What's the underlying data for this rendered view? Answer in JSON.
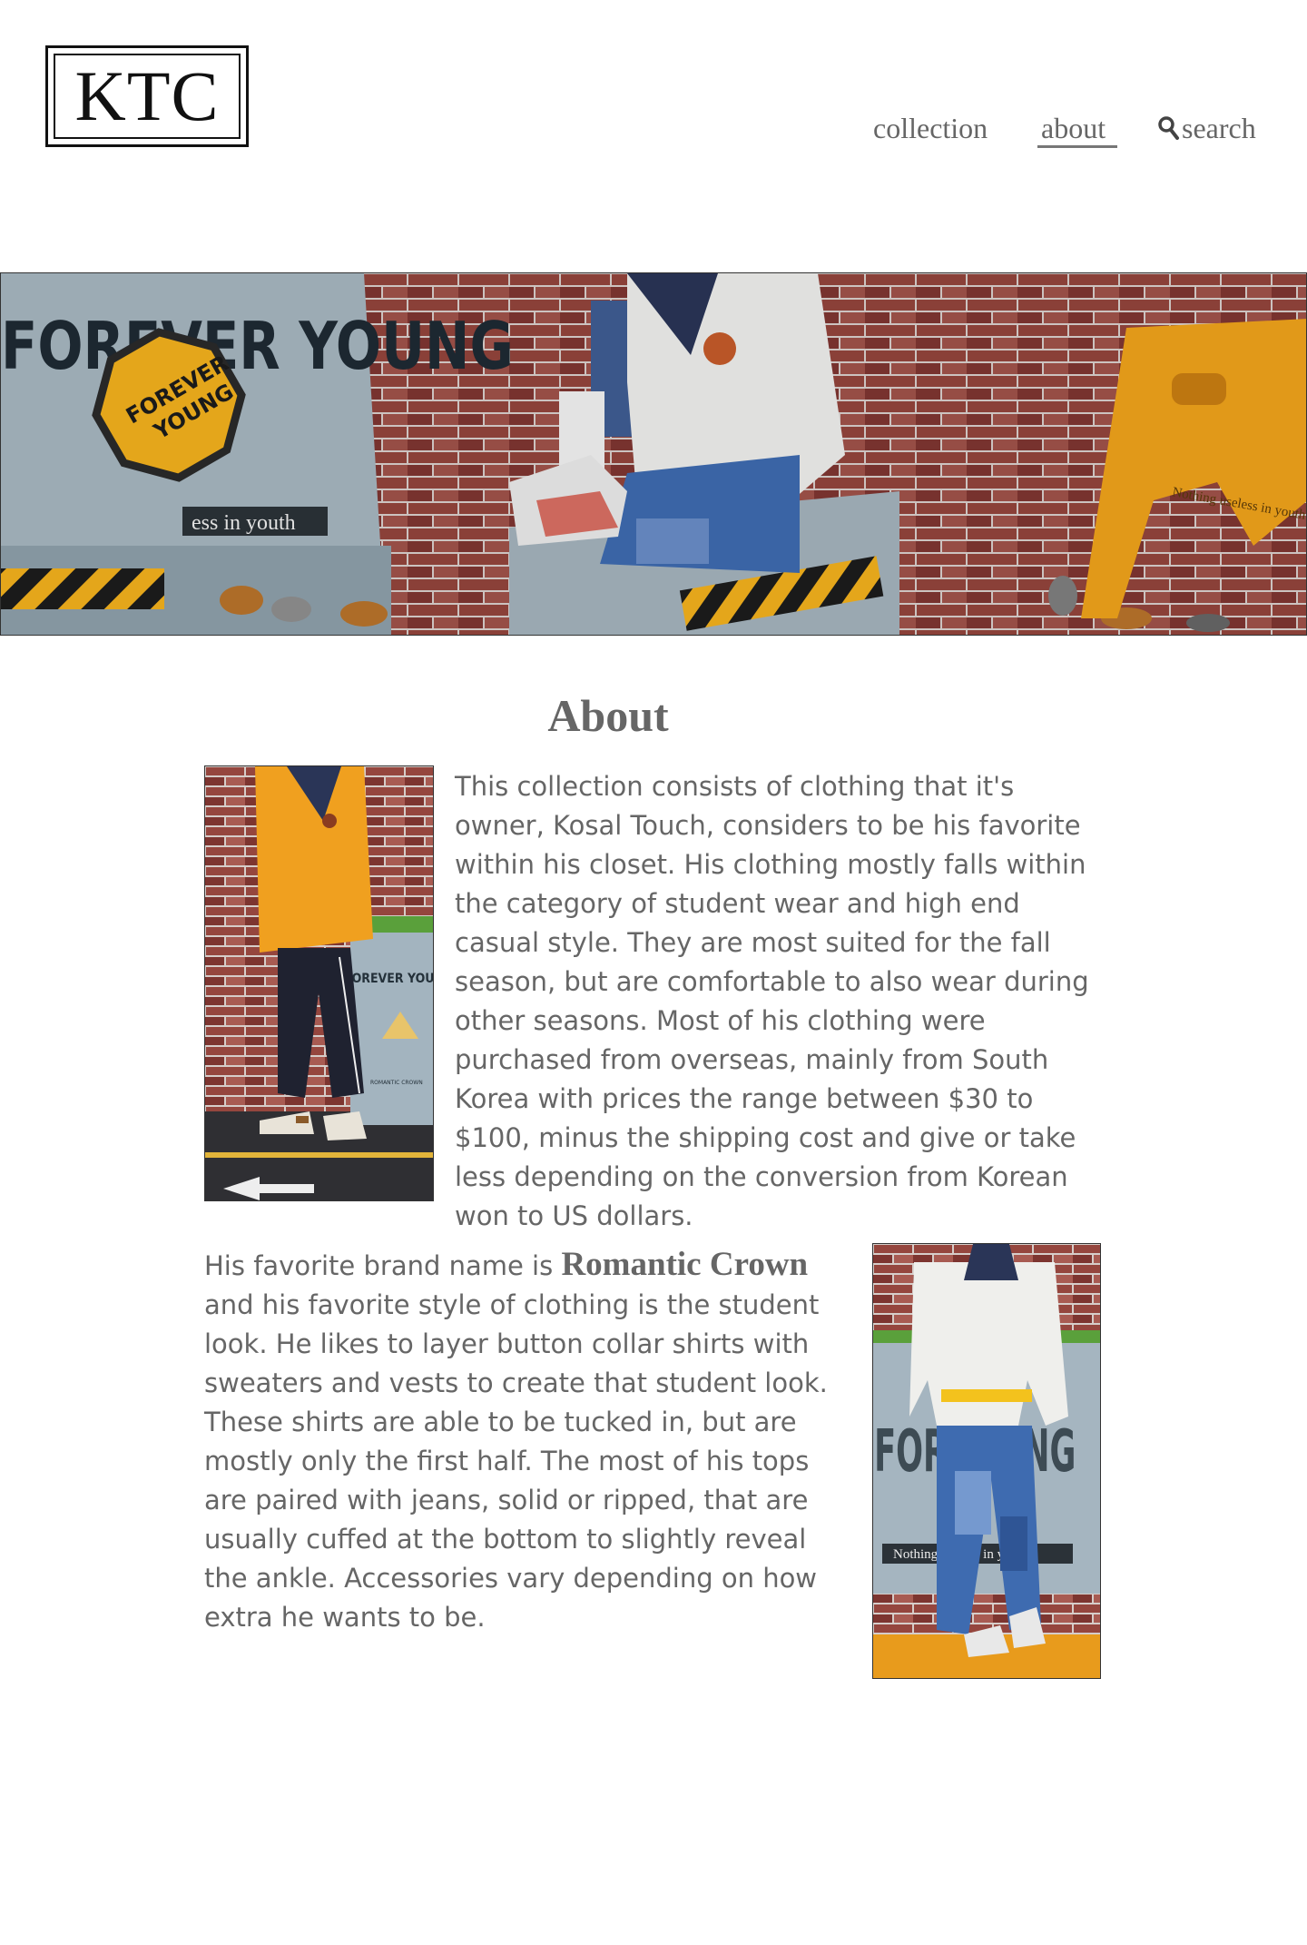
{
  "header": {
    "logo_text": "KTC",
    "nav": {
      "collection": "collection",
      "about": "about",
      "search": "search",
      "active": "about"
    }
  },
  "hero": {
    "sign_text": "FOREVER YOUNG",
    "badge_line1": "FOREVER",
    "badge_line2": "YOUNG",
    "strip_text": "ess in youth",
    "right_sign_text": "Nothing useless in youth"
  },
  "about": {
    "title": "About",
    "paragraph1": "This collection consists of clothing that it's owner, Kosal Touch, considers to be his favorite within his closet. His clothing mostly falls within the category of student wear and high end casual style. They are most suited for the fall season, but are comfortable to also wear during other seasons. Most of his clothing were purchased from overseas, mainly from South Korea with prices the range between $30 to $100, minus the shipping cost and give or take less depending on the conversion from Korean won to US dollars.",
    "paragraph2_lead": "His favorite brand name is ",
    "brand_name": "Romantic Crown",
    "paragraph2_rest": "and his favorite style of clothing is the student look. He likes to layer button collar shirts with sweaters and vests to create that student look. These shirts are able to be tucked in, but are mostly only the first half. The most of his tops are paired with jeans, solid or ripped, that are usually cuffed at the bottom to slightly reveal the ankle. Accessories vary depending on how extra he wants to be.",
    "photo1_bin_text": "FOREVER YOUN",
    "photo1_bin_label": "ROMANTIC CROWN",
    "photo2_strip_text": "Nothing useless in youth"
  },
  "colors": {
    "brick": "#8e3d36",
    "mortar": "#d8cfcc",
    "bin_blue": "#9fb0bb",
    "accent_yellow": "#f5a623",
    "text_gray": "#666666"
  }
}
